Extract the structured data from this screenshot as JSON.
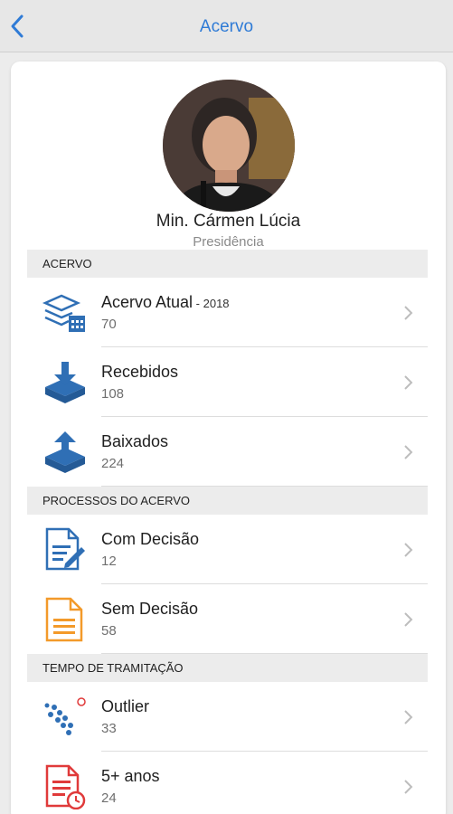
{
  "nav": {
    "title": "Acervo",
    "back_icon": "chevron-left-icon"
  },
  "profile": {
    "name": "Min. Cármen Lúcia",
    "role": "Presidência"
  },
  "sections": [
    {
      "header": "ACERVO",
      "items": [
        {
          "label": "Acervo Atual",
          "suffix": " - 2018",
          "count": "70",
          "icon": "stack-calendar-icon"
        },
        {
          "label": "Recebidos",
          "count": "108",
          "icon": "tray-download-icon"
        },
        {
          "label": "Baixados",
          "count": "224",
          "icon": "tray-upload-icon"
        }
      ]
    },
    {
      "header": "PROCESSOS DO ACERVO",
      "items": [
        {
          "label": "Com Decisão",
          "count": "12",
          "icon": "document-edit-icon"
        },
        {
          "label": "Sem Decisão",
          "count": "58",
          "icon": "document-icon"
        }
      ]
    },
    {
      "header": "TEMPO DE TRAMITAÇÃO",
      "items": [
        {
          "label": "Outlier",
          "count": "33",
          "icon": "scatter-dots-icon"
        },
        {
          "label": "5+ anos",
          "count": "24",
          "icon": "document-clock-icon"
        }
      ]
    }
  ],
  "colors": {
    "accent": "#2f7bd6",
    "icon_blue": "#2f6fb5",
    "icon_orange": "#f39a2a",
    "icon_red": "#e03a3a"
  }
}
